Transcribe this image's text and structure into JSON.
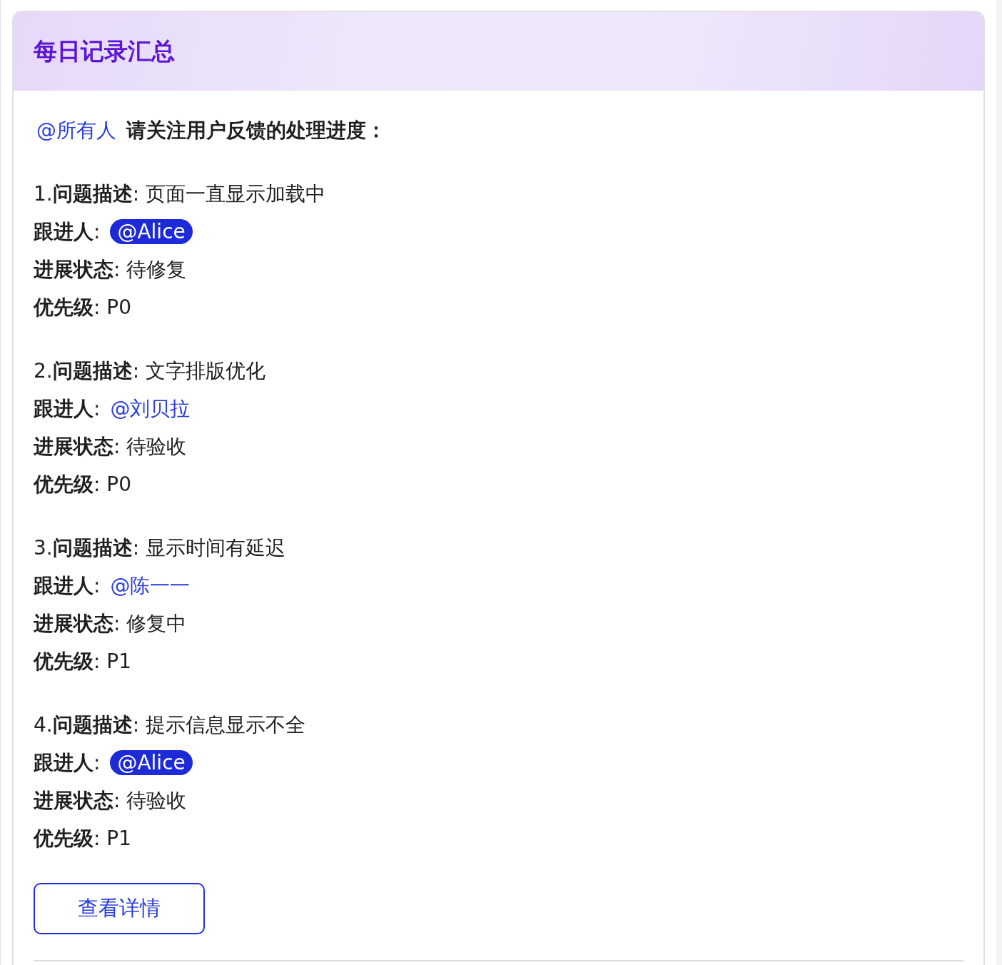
{
  "card": {
    "title": "每日记录汇总",
    "intro": {
      "mention": "@所有人",
      "text": "请关注用户反馈的处理进度："
    },
    "issues": [
      {
        "lines": [
          {
            "kind": "text",
            "text": "1.**问题描述**: 页面一直显示加载中"
          },
          {
            "kind": "mention",
            "label": "**跟进人**:",
            "mention": "@Alice",
            "highlighted": true
          },
          {
            "kind": "text",
            "text": "**进展状态**: 待修复"
          },
          {
            "kind": "text",
            "text": "**优先级**: P0"
          }
        ]
      },
      {
        "lines": [
          {
            "kind": "text",
            "text": "2.**问题描述**: 文字排版优化"
          },
          {
            "kind": "mention",
            "label": "**跟进人**:",
            "mention": "@刘贝拉",
            "highlighted": false
          },
          {
            "kind": "text",
            "text": "**进展状态**: 待验收"
          },
          {
            "kind": "text",
            "text": "**优先级**: P0"
          }
        ]
      },
      {
        "lines": [
          {
            "kind": "text",
            "text": "3.**问题描述**: 显示时间有延迟"
          },
          {
            "kind": "mention",
            "label": "**跟进人**:",
            "mention": "@陈一一",
            "highlighted": false
          },
          {
            "kind": "text",
            "text": "**进展状态**: 修复中"
          },
          {
            "kind": "text",
            "text": "**优先级**: P1"
          }
        ]
      },
      {
        "lines": [
          {
            "kind": "text",
            "text": "4.**问题描述**: 提示信息显示不全"
          },
          {
            "kind": "mention",
            "label": "**跟进人**:",
            "mention": "@Alice",
            "highlighted": true
          },
          {
            "kind": "text",
            "text": "**进展状态**: 待验收"
          },
          {
            "kind": "text",
            "text": "**优先级**: P1"
          }
        ]
      }
    ],
    "button": "查看详情"
  }
}
